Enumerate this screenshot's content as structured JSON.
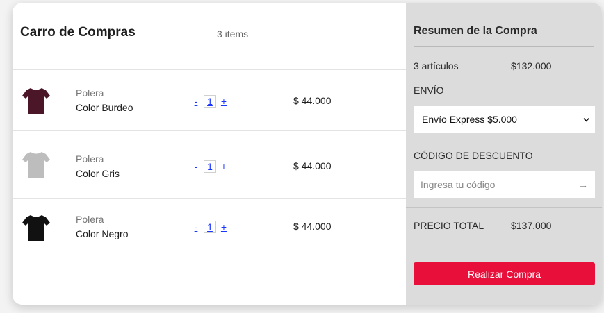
{
  "cart": {
    "title": "Carro de Compras",
    "count_label": "3 items",
    "items": [
      {
        "type": "Polera",
        "color_label": "Color Burdeo",
        "qty_minus": "-",
        "qty": "1",
        "qty_plus": "+",
        "price": "$ 44.000",
        "shirt_color": "#4a1628"
      },
      {
        "type": "Polera",
        "color_label": "Color Gris",
        "qty_minus": "-",
        "qty": "1",
        "qty_plus": "+",
        "price": "$ 44.000",
        "shirt_color": "#bdbdbd"
      },
      {
        "type": "Polera",
        "color_label": "Color Negro",
        "qty_minus": "-",
        "qty": "1",
        "qty_plus": "+",
        "price": "$ 44.000",
        "shirt_color": "#111111"
      }
    ]
  },
  "summary": {
    "title": "Resumen de la Compra",
    "items_label": "3 artículos",
    "items_total": "$132.000",
    "shipping_label": "ENVÍO",
    "shipping_selected": "Envío Express $5.000",
    "discount_label": "CÓDIGO DE DESCUENTO",
    "discount_placeholder": "Ingresa tu código",
    "apply_arrow": "→",
    "total_label": "PRECIO TOTAL",
    "total_value": "$137.000",
    "buy_label": "Realizar Compra"
  },
  "colors": {
    "accent": "#e8103a",
    "summary_bg": "#dcdcdc",
    "link": "#1a35ff"
  },
  "icons": [
    "tshirt-icon",
    "chevron-down-icon",
    "arrow-right-icon"
  ]
}
